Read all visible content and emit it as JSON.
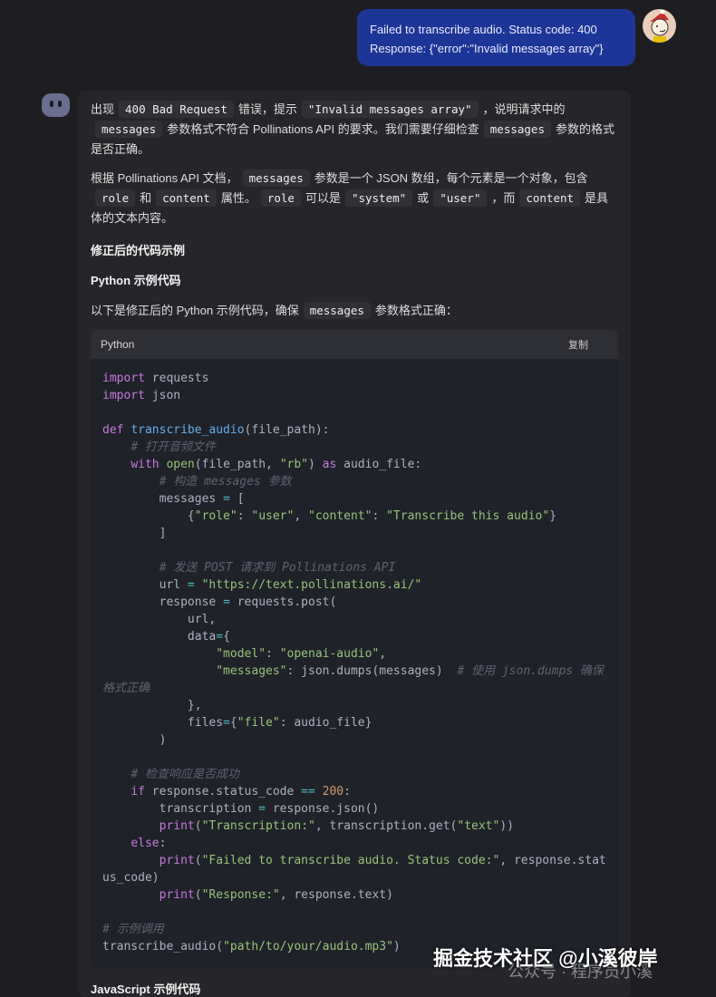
{
  "user_message": {
    "line1": "Failed to transcribe audio. Status code: 400",
    "line2": "Response: {\"error\":\"Invalid messages array\"}"
  },
  "answer": {
    "p1": [
      "出现",
      "400 Bad Request",
      "错误，提示",
      "\"Invalid messages array\"",
      "，说明请求中的",
      "messages",
      "参数格式不符合 Pollinations API 的要求。我们需要仔细检查",
      "messages",
      "参数的格式是否正确。"
    ],
    "p2": [
      "根据 Pollinations API 文档，",
      "messages",
      "参数是一个 JSON 数组，每个元素是一个对象，包含",
      "role",
      "和",
      "content",
      "属性。",
      "role",
      "可以是",
      "\"system\"",
      "或",
      "\"user\"",
      "，而",
      "content",
      "是具体的文本内容。"
    ],
    "h_fixed": "修正后的代码示例",
    "h_python": "Python 示例代码",
    "p3": [
      "以下是修正后的 Python 示例代码，确保",
      "messages",
      "参数格式正确："
    ],
    "code_lang": "Python",
    "copy_label": "复制",
    "h_js": "JavaScript 示例代码"
  },
  "code_lines": [
    [
      [
        "kw",
        "import"
      ],
      [
        "pl",
        " requests"
      ]
    ],
    [
      [
        "kw",
        "import"
      ],
      [
        "pl",
        " json"
      ]
    ],
    [],
    [
      [
        "kw",
        "def"
      ],
      [
        "pl",
        " "
      ],
      [
        "fn",
        "transcribe_audio"
      ],
      [
        "pl",
        "(file_path):"
      ]
    ],
    [
      [
        "pl",
        "    "
      ],
      [
        "cm",
        "# 打开音频文件"
      ]
    ],
    [
      [
        "pl",
        "    "
      ],
      [
        "kw",
        "with"
      ],
      [
        "pl",
        " "
      ],
      [
        "bi",
        "open"
      ],
      [
        "pl",
        "(file_path, "
      ],
      [
        "str",
        "\"rb\""
      ],
      [
        "pl",
        ") "
      ],
      [
        "kw",
        "as"
      ],
      [
        "pl",
        " audio_file:"
      ]
    ],
    [
      [
        "pl",
        "        "
      ],
      [
        "cm",
        "# 构造 messages 参数"
      ]
    ],
    [
      [
        "pl",
        "        messages "
      ],
      [
        "op",
        "="
      ],
      [
        "pl",
        " ["
      ]
    ],
    [
      [
        "pl",
        "            {"
      ],
      [
        "str",
        "\"role\""
      ],
      [
        "pl",
        ": "
      ],
      [
        "str",
        "\"user\""
      ],
      [
        "pl",
        ", "
      ],
      [
        "str",
        "\"content\""
      ],
      [
        "pl",
        ": "
      ],
      [
        "str",
        "\"Transcribe this audio\""
      ],
      [
        "pl",
        "}"
      ]
    ],
    [
      [
        "pl",
        "        ]"
      ]
    ],
    [],
    [
      [
        "pl",
        "        "
      ],
      [
        "cm",
        "# 发送 POST 请求到 Pollinations API"
      ]
    ],
    [
      [
        "pl",
        "        url "
      ],
      [
        "op",
        "="
      ],
      [
        "pl",
        " "
      ],
      [
        "str",
        "\"https://text.pollinations.ai/\""
      ]
    ],
    [
      [
        "pl",
        "        response "
      ],
      [
        "op",
        "="
      ],
      [
        "pl",
        " requests.post("
      ]
    ],
    [
      [
        "pl",
        "            url,"
      ]
    ],
    [
      [
        "pl",
        "            data"
      ],
      [
        "op",
        "="
      ],
      [
        "pl",
        "{"
      ]
    ],
    [
      [
        "pl",
        "                "
      ],
      [
        "str",
        "\"model\""
      ],
      [
        "pl",
        ": "
      ],
      [
        "str",
        "\"openai-audio\""
      ],
      [
        "pl",
        ","
      ]
    ],
    [
      [
        "pl",
        "                "
      ],
      [
        "str",
        "\"messages\""
      ],
      [
        "pl",
        ": json.dumps(messages)  "
      ],
      [
        "cm",
        "# 使用 json.dumps 确保格式正确"
      ]
    ],
    [
      [
        "pl",
        "            },"
      ]
    ],
    [
      [
        "pl",
        "            files"
      ],
      [
        "op",
        "="
      ],
      [
        "pl",
        "{"
      ],
      [
        "str",
        "\"file\""
      ],
      [
        "pl",
        ": audio_file}"
      ]
    ],
    [
      [
        "pl",
        "        )"
      ]
    ],
    [],
    [
      [
        "pl",
        "    "
      ],
      [
        "cm",
        "# 检查响应是否成功"
      ]
    ],
    [
      [
        "pl",
        "    "
      ],
      [
        "kw",
        "if"
      ],
      [
        "pl",
        " response.status_code "
      ],
      [
        "op",
        "=="
      ],
      [
        "pl",
        " "
      ],
      [
        "num",
        "200"
      ],
      [
        "pl",
        ":"
      ]
    ],
    [
      [
        "pl",
        "        transcription "
      ],
      [
        "op",
        "="
      ],
      [
        "pl",
        " response.json()"
      ]
    ],
    [
      [
        "pl",
        "        "
      ],
      [
        "kw",
        "print"
      ],
      [
        "pl",
        "("
      ],
      [
        "str",
        "\"Transcription:\""
      ],
      [
        "pl",
        ", transcription.get("
      ],
      [
        "str",
        "\"text\""
      ],
      [
        "pl",
        "))"
      ]
    ],
    [
      [
        "pl",
        "    "
      ],
      [
        "kw",
        "else"
      ],
      [
        "pl",
        ":"
      ]
    ],
    [
      [
        "pl",
        "        "
      ],
      [
        "kw",
        "print"
      ],
      [
        "pl",
        "("
      ],
      [
        "str",
        "\"Failed to transcribe audio. Status code:\""
      ],
      [
        "pl",
        ", response.status_code)"
      ]
    ],
    [
      [
        "pl",
        "        "
      ],
      [
        "kw",
        "print"
      ],
      [
        "pl",
        "("
      ],
      [
        "str",
        "\"Response:\""
      ],
      [
        "pl",
        ", response.text)"
      ]
    ],
    [],
    [
      [
        "cm",
        "# 示例调用"
      ]
    ],
    [
      [
        "pl",
        "transcribe_audio("
      ],
      [
        "str",
        "\"path/to/your/audio.mp3\""
      ],
      [
        "pl",
        ")"
      ]
    ]
  ],
  "watermark": {
    "main": "掘金技术社区 @小溪彼岸",
    "sub": "公众号 · 程序员小溪"
  },
  "colors": {
    "user_bubble": "#1d3596",
    "background": "#1e1e22",
    "card": "#26262a"
  }
}
